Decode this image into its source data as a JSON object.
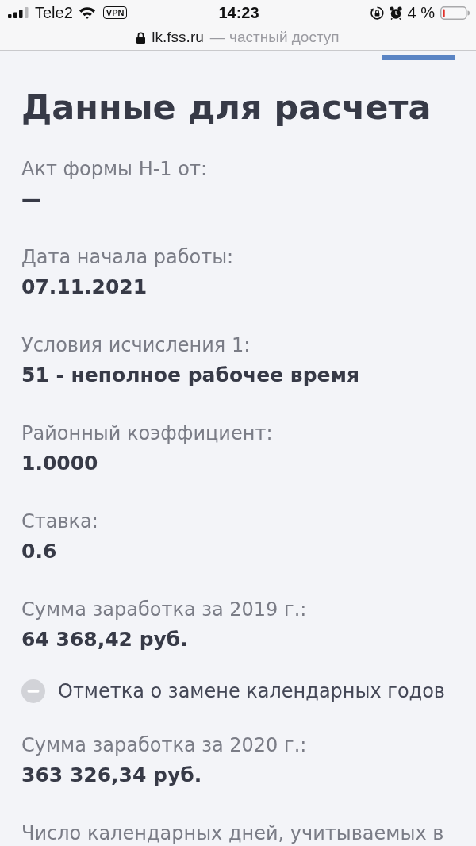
{
  "status_bar": {
    "carrier": "Tele2",
    "vpn": "VPN",
    "time": "14:23",
    "battery": "4 %"
  },
  "address_bar": {
    "domain": "lk.fss.ru",
    "note": "— частный доступ"
  },
  "section": {
    "title": "Данные для расчета",
    "fields": [
      {
        "kind": "field",
        "label": "Акт формы Н-1 от:",
        "value": "—"
      },
      {
        "kind": "field",
        "label": "Дата начала работы:",
        "value": "07.11.2021"
      },
      {
        "kind": "field",
        "label": "Условия исчисления 1:",
        "value": "51 - неполное рабочее время"
      },
      {
        "kind": "field",
        "label": "Районный коэффициент:",
        "value": "1.0000"
      },
      {
        "kind": "field",
        "label": "Ставка:",
        "value": "0.6"
      },
      {
        "kind": "field",
        "label": "Сумма заработка за 2019 г.:",
        "value": "64 368,42 руб."
      },
      {
        "kind": "flag",
        "label": "Отметка о замене календарных годов",
        "checked": false
      },
      {
        "kind": "field",
        "label": "Сумма заработка за 2020 г.:",
        "value": "363 326,34 руб."
      },
      {
        "kind": "field",
        "label": "Число календарных дней, учитываемых в"
      }
    ]
  }
}
